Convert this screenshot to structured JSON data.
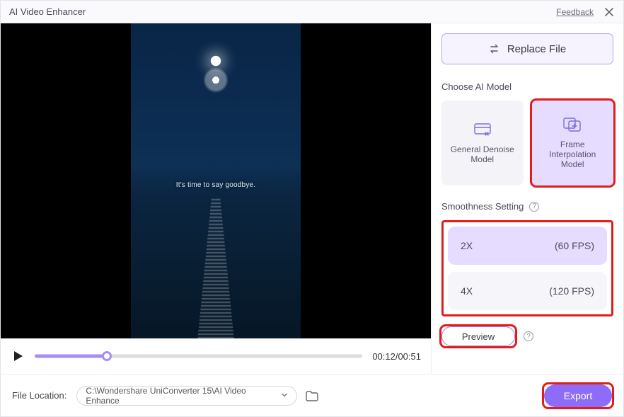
{
  "titlebar": {
    "title": "AI Video Enhancer",
    "feedback": "Feedback"
  },
  "video": {
    "caption": "It's time to say goodbye."
  },
  "transport": {
    "time": "00:12/00:51"
  },
  "panel": {
    "replace_label": "Replace File",
    "model_section": "Choose AI Model",
    "models": [
      {
        "label": "General Denoise Model"
      },
      {
        "label": "Frame Interpolation Model"
      }
    ],
    "smoothness_section": "Smoothness Setting",
    "smoothness": [
      {
        "mult": "2X",
        "fps": "(60 FPS)"
      },
      {
        "mult": "4X",
        "fps": "(120 FPS)"
      }
    ],
    "preview": "Preview"
  },
  "footer": {
    "label": "File Location:",
    "path": "C:\\Wondershare UniConverter 15\\AI Video Enhance",
    "export": "Export"
  }
}
